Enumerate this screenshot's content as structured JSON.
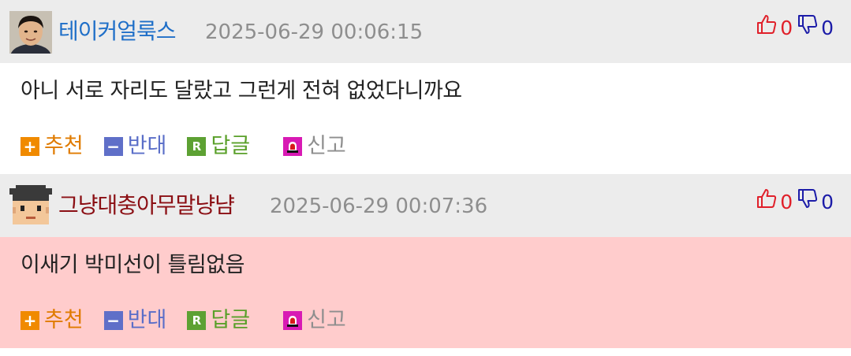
{
  "comments": [
    {
      "nickname": "테이커얼룩스",
      "nickname_color": "#1f6fc8",
      "timestamp": "2025-06-29 00:06:15",
      "upvotes": "0",
      "downvotes": "0",
      "text": "아니 서로 자리도 달랐고 그런게 전혀 없었다니까요",
      "highlight": false,
      "actions": {
        "recommend": "추천",
        "oppose": "반대",
        "reply": "답글",
        "report": "신고"
      }
    },
    {
      "nickname": "그냥대충아무말냥냠",
      "nickname_color": "#8b0f14",
      "timestamp": "2025-06-29 00:07:36",
      "upvotes": "0",
      "downvotes": "0",
      "text": "이새기 박미선이 틀림없음",
      "highlight": true,
      "highlight_color": "#ffcccc",
      "actions": {
        "recommend": "추천",
        "oppose": "반대",
        "reply": "답글",
        "report": "신고"
      }
    }
  ],
  "icons": {
    "recommend": "plus-icon",
    "oppose": "minus-icon",
    "reply": "reply-r-icon",
    "report": "siren-icon",
    "upvote": "thumbs-up-icon",
    "downvote": "thumbs-down-icon"
  }
}
